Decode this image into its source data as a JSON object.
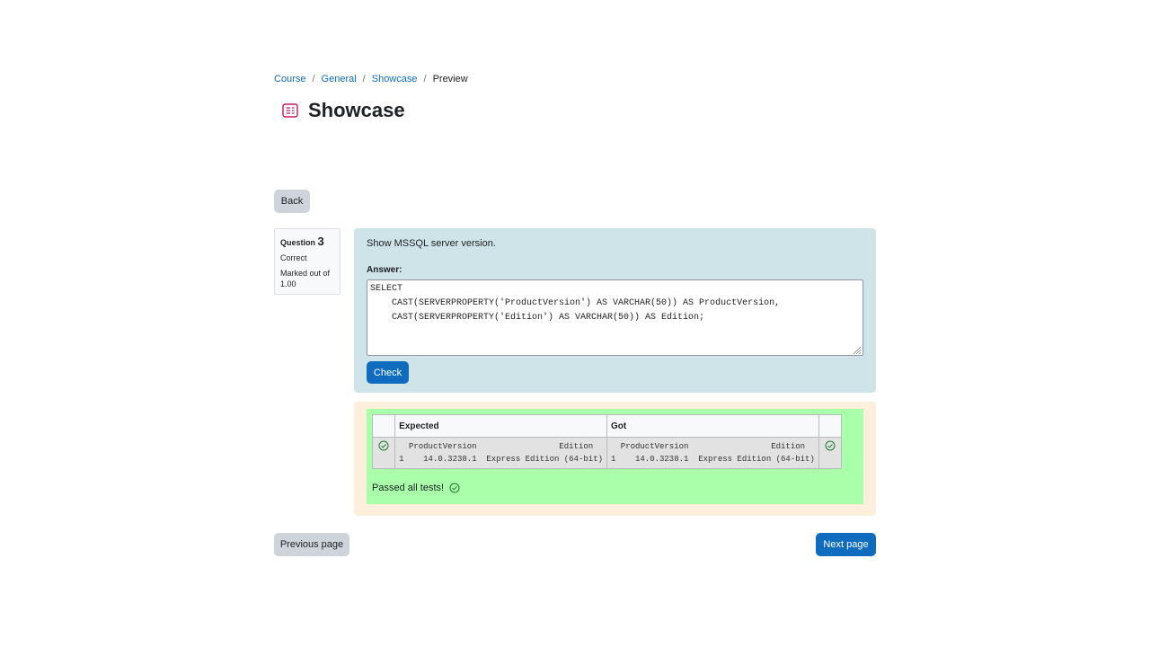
{
  "breadcrumb": [
    {
      "label": "Course",
      "link": true
    },
    {
      "label": "General",
      "link": true
    },
    {
      "label": "Showcase",
      "link": true
    },
    {
      "label": "Preview",
      "link": false
    }
  ],
  "header": {
    "title": "Showcase",
    "icon": "quiz-icon"
  },
  "buttons": {
    "back": "Back",
    "check": "Check",
    "previous": "Previous page",
    "next": "Next page"
  },
  "question_info": {
    "label": "Question",
    "number": "3",
    "state": "Correct",
    "marked_out_of": "Marked out of 1.00"
  },
  "question": {
    "text": "Show MSSQL server version.",
    "answer_label": "Answer:",
    "answer": "SELECT\n    CAST(SERVERPROPERTY('ProductVersion') AS VARCHAR(50)) AS ProductVersion,\n    CAST(SERVERPROPERTY('Edition') AS VARCHAR(50)) AS Edition;"
  },
  "results": {
    "headers": [
      "",
      "Expected",
      "Got",
      ""
    ],
    "rows": [
      {
        "status": "correct",
        "expected": "  ProductVersion                 Edition\n1    14.0.3238.1  Express Edition (64-bit)",
        "got": "  ProductVersion                 Edition\n1    14.0.3238.1  Express Edition (64-bit)"
      }
    ],
    "summary": "Passed all tests!"
  },
  "colors": {
    "primary": "#0f6cbf",
    "formulation_bg": "#cfe4e8",
    "outcome_bg": "#fcefdc",
    "pass_bg": "#aaffaa",
    "icon_pink": "#c2185b"
  }
}
